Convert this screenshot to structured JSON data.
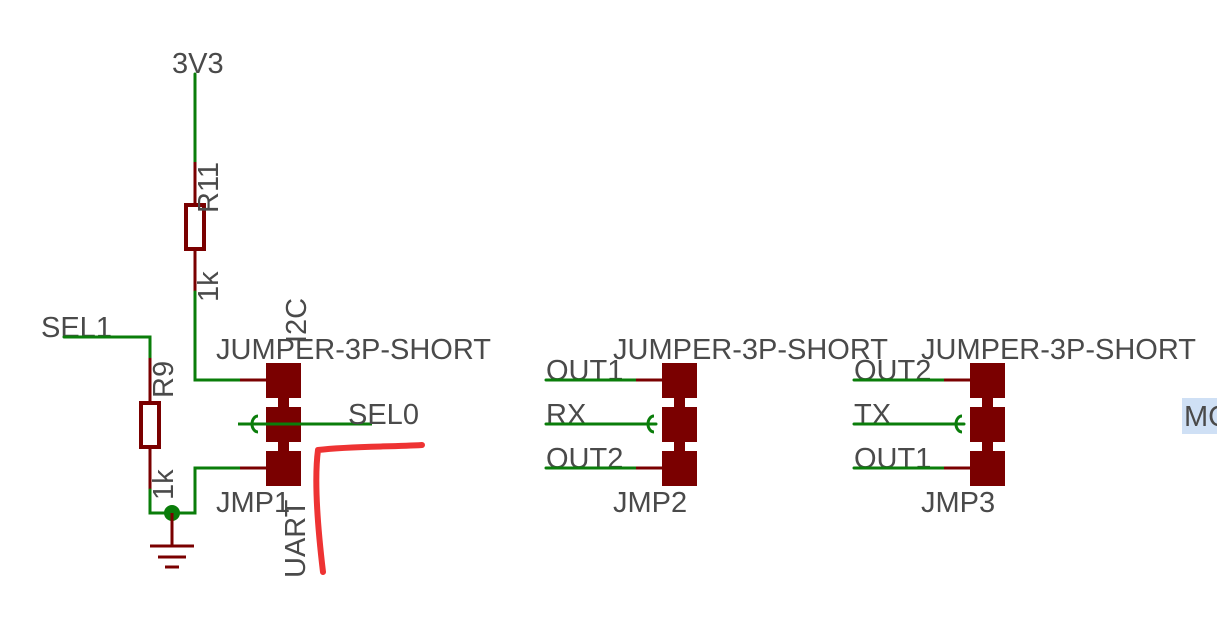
{
  "colors": {
    "wire": "#0a7d0a",
    "part": "#7a0000",
    "label_text": "#4a4a4a",
    "annotation": "#ee3333",
    "selection_highlight": "#cfe0f5"
  },
  "labels": {
    "power": "3V3",
    "r11_name": "R11",
    "r11_value": "1k",
    "r9_name": "R9",
    "r9_value": "1k",
    "net_sel1": "SEL1",
    "net_sel0": "SEL0",
    "jmp1_mode_top": "I2C",
    "jmp1_mode_bottom": "UART",
    "jmp1_type": "JUMPER-3P-SHORT",
    "jmp1_name": "JMP1",
    "jmp2_type": "JUMPER-3P-SHORT",
    "jmp2_name": "JMP2",
    "jmp2_pin1": "OUT1",
    "jmp2_pin2": "RX",
    "jmp2_pin3": "OUT2",
    "jmp3_type": "JUMPER-3P-SHORT",
    "jmp3_name": "JMP3",
    "jmp3_pin1": "OUT2",
    "jmp3_pin2": "TX",
    "jmp3_pin3": "OUT1",
    "cut_text": "MC"
  }
}
